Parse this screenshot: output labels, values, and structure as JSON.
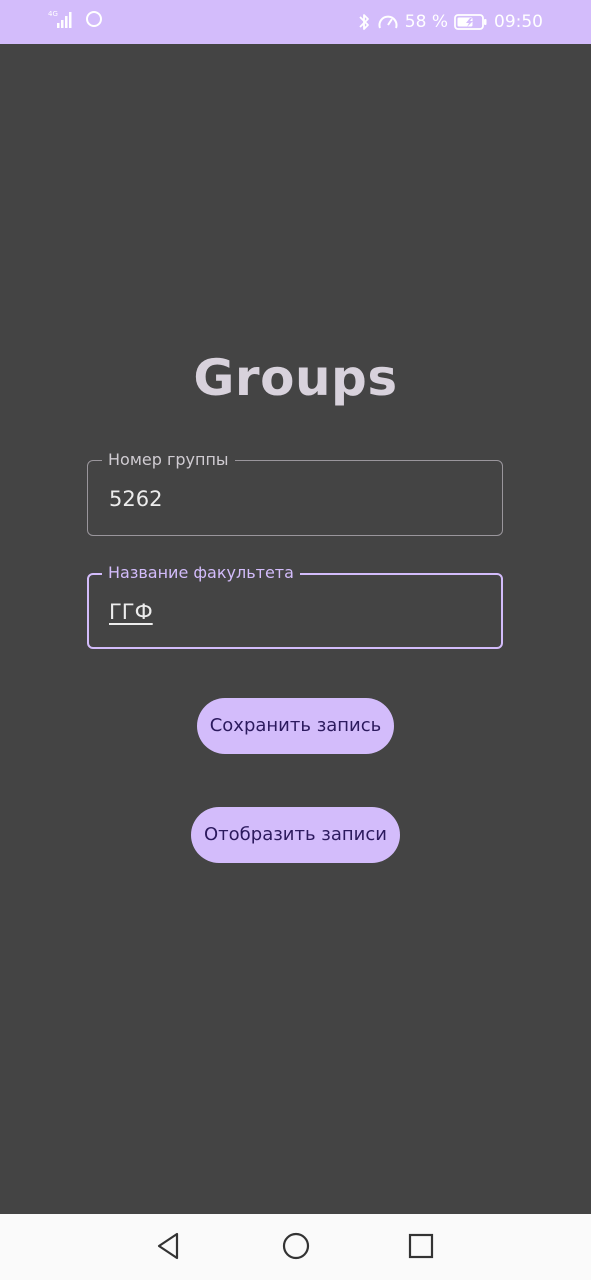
{
  "status_bar": {
    "network_label": "4G",
    "battery_percent_text": "58 %",
    "time": "09:50",
    "icons": [
      "signal-icon",
      "sync-icon",
      "bluetooth-icon",
      "speedometer-icon",
      "battery-icon"
    ]
  },
  "page": {
    "title": "Groups"
  },
  "form": {
    "group_number": {
      "label": "Номер группы",
      "value": "5262"
    },
    "faculty_name": {
      "label": "Название факультета",
      "value": "ГГФ"
    }
  },
  "buttons": {
    "save_label": "Сохранить запись",
    "show_label": "Отобразить записи"
  },
  "nav_bar": {
    "icons": [
      "back-icon",
      "home-icon",
      "recents-icon"
    ]
  },
  "colors": {
    "accent": "#d3bcfb",
    "background": "#444444",
    "button_text": "#2c1a5e",
    "title": "#d8d2dc"
  }
}
